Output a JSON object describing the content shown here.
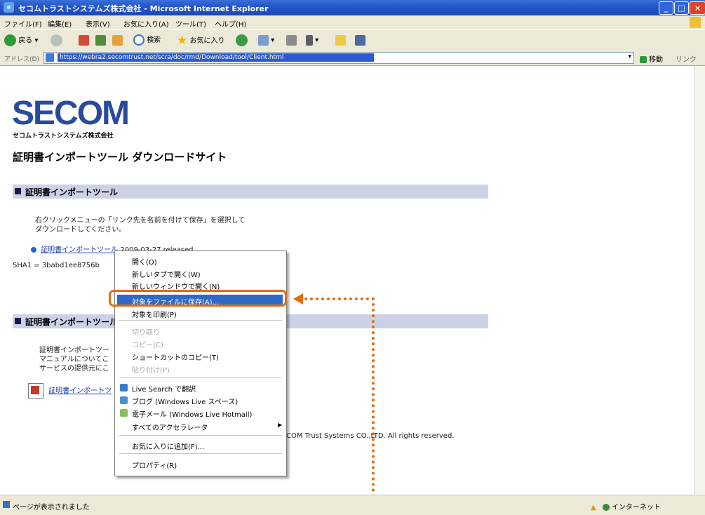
{
  "window": {
    "title": "セコムトラストシステムズ株式会社 - Microsoft Internet Explorer"
  },
  "menubar": [
    "ファイル(F)",
    "編集(E)",
    "表示(V)",
    "お気に入り(A)",
    "ツール(T)",
    "ヘルプ(H)"
  ],
  "toolbar": {
    "back": "戻る",
    "search": "検索",
    "favorites": "お気に入り"
  },
  "addressbar": {
    "label": "アドレス(D)",
    "url": "https://webra2.secomtrust.net/scra/doc/rmd/Download/tool/Client.html",
    "go": "移動",
    "links": "リンク"
  },
  "page": {
    "logo": "SECOM",
    "logo_sub": "セコムトラストシステムズ株式会社",
    "title": "証明書インポートツール ダウンロードサイト",
    "section1_title": "証明書インポートツール",
    "instruction_line1": "右クリックメニューの「リンク先を名前を付けて保存」を選択して",
    "instruction_line2": "ダウンロードしてください。",
    "tool_link": "証明書インポートツール",
    "tool_release": "2009-03-27 released",
    "sha1": "SHA1 = 3babd1ee8756b",
    "section2_title": "証明書インポートツール",
    "body_line1": "証明書インポートツー",
    "body_line2": "マニュアルについてこ",
    "body_line3": "サービスの提供元にこ",
    "pdf_link": "証明書インポートツ",
    "copyright": "COM Trust Systems CO.,LTD. All rights reserved."
  },
  "context_menu": {
    "items": [
      "開く(O)",
      "新しいタブで開く(W)",
      "新しいウィンドウで開く(N)",
      "対象をファイルに保存(A)...",
      "対象を印刷(P)",
      "切り取り",
      "コピー(C)",
      "ショートカットのコピー(T)",
      "貼り付け(P)",
      "Live Search で翻訳",
      "ブログ (Windows Live スペース)",
      "電子メール (Windows Live Hotmail)",
      "すべてのアクセラレータ",
      "お気に入りに追加(F)...",
      "プロパティ(R)"
    ]
  },
  "statusbar": {
    "status": "ページが表示されました",
    "zone": "インターネット"
  },
  "colors": {
    "highlight": "#316ac5",
    "callout": "#e46c0a",
    "section_band": "#cbd2e6",
    "logo": "#2a4b9b"
  }
}
